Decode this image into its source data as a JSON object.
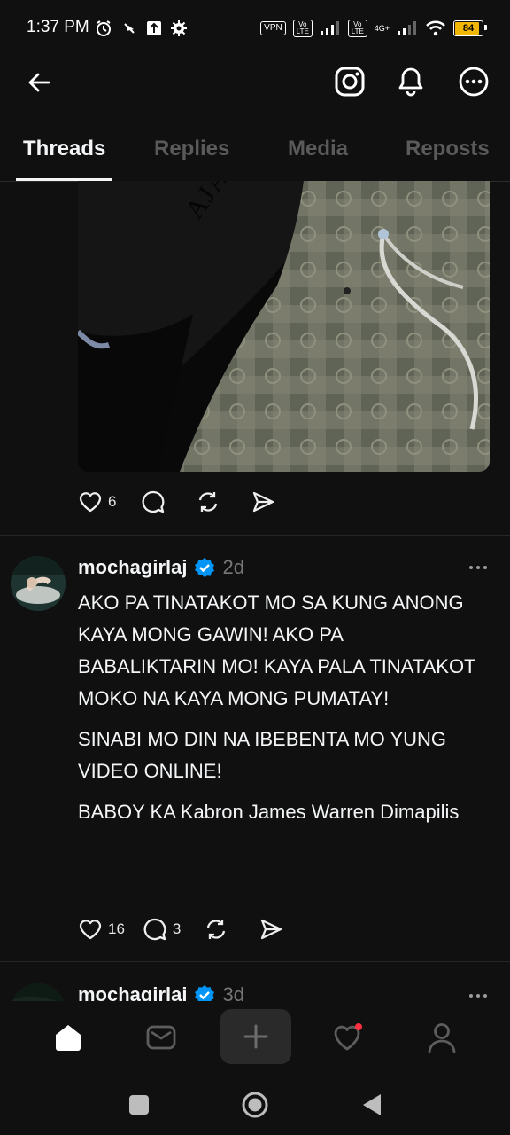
{
  "status_bar": {
    "time": "1:37 PM",
    "vpn": "VPN",
    "volte1": "Vo LTE",
    "volte2": "Vo LTE",
    "network": "4G+",
    "battery": "84"
  },
  "top_bar": {
    "icons": [
      "back-arrow-icon",
      "instagram-icon",
      "bell-icon",
      "more-circle-icon"
    ]
  },
  "tabs": [
    {
      "label": "Threads",
      "active": true
    },
    {
      "label": "Replies",
      "active": false
    },
    {
      "label": "Media",
      "active": false
    },
    {
      "label": "Reposts",
      "active": false
    }
  ],
  "first_post": {
    "image_text": "AJA JE",
    "likes": "6"
  },
  "second_post": {
    "username": "mochagirlaj",
    "time": "2d",
    "paragraphs": [
      "AKO PA TINATAKOT MO SA KUNG ANONG KAYA MONG GAWIN! AKO PA BABALIKTARIN MO! KAYA PALA TINATAKOT MOKO NA KAYA MONG PUMATAY!",
      "SINABI MO DIN NA IBEBENTA MO YUNG VIDEO ONLINE!",
      "BABOY KA Kabron James Warren Dimapilis"
    ],
    "likes": "16",
    "replies": "3"
  },
  "third_post": {
    "username": "mochagirlaj",
    "time": "3d"
  },
  "colors": {
    "background": "#101010",
    "verified": "#0095f6",
    "notification_dot": "#ff3040",
    "battery": "#f2b705"
  }
}
